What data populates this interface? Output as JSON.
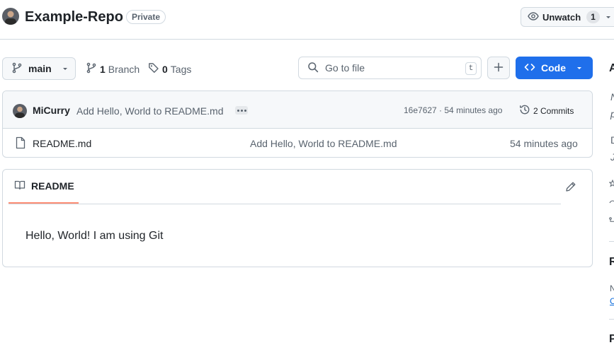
{
  "repo": {
    "name": "Example-Repo",
    "visibility": "Private"
  },
  "watch": {
    "label": "Unwatch",
    "count": "1"
  },
  "toolbar": {
    "branch": "main",
    "branches_count": "1",
    "branches_label": "Branch",
    "tags_count": "0",
    "tags_label": "Tags",
    "go_to_file_placeholder": "Go to file",
    "go_to_file_shortcut": "t",
    "code_label": "Code"
  },
  "latest_commit": {
    "author": "MiCurry",
    "message": "Add Hello, World to README.md",
    "meta": "16e7627 · 54 minutes ago",
    "commits_label": "2 Commits"
  },
  "files": [
    {
      "name": "README.md",
      "commit_message": "Add Hello, World to README.md",
      "time": "54 minutes ago"
    }
  ],
  "readme": {
    "tab_label": "README",
    "content": "Hello, World! I am using Git"
  },
  "sidebar": {
    "about_initial": "A",
    "desc_line1": "N",
    "desc_line2": "p",
    "item1": "D",
    "item2": "J",
    "section1_initial": "R",
    "small_initial": "N",
    "link_initial": "C",
    "section2_initial": "P"
  },
  "colors": {
    "accent": "#1f6feb",
    "tab_underline": "#fd8c73",
    "border": "#d1d9e0"
  }
}
